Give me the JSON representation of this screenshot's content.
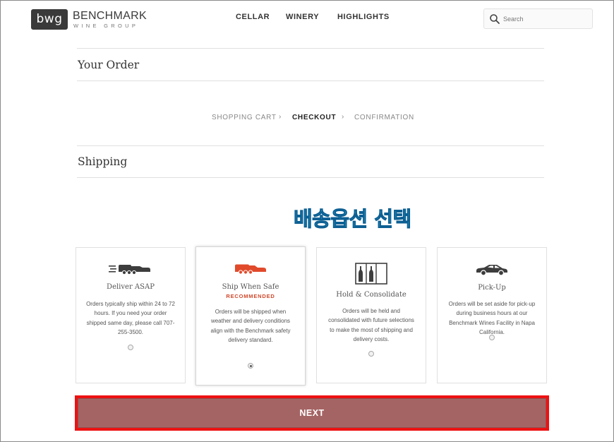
{
  "header": {
    "logo_mark": "bwg",
    "logo_name": "BENCHMARK",
    "logo_sub": "WINE GROUP",
    "nav": [
      "CELLAR",
      "WINERY",
      "HIGHLIGHTS"
    ],
    "search": {
      "placeholder": "Search",
      "icon": "magnifier-icon"
    }
  },
  "order_title": "Your Order",
  "breadcrumb": {
    "steps": [
      "SHOPPING CART",
      "CHECKOUT",
      "CONFIRMATION"
    ],
    "active": "CHECKOUT",
    "separator": "›"
  },
  "shipping_title": "Shipping",
  "annotation": "배송옵션 선택",
  "options": [
    {
      "title": "Deliver ASAP",
      "tag": "",
      "description": "Orders typically ship within 24 to 72 hours. If you need your order shipped same day, please call 707-255-3500.",
      "icon": "fast-truck-icon",
      "selected": false
    },
    {
      "title": "Ship When Safe",
      "tag": "RECOMMENDED",
      "description": "Orders will be shipped when weather and delivery conditions align with the Benchmark safety delivery standard.",
      "icon": "truck-icon",
      "selected": true
    },
    {
      "title": "Hold & Consolidate",
      "tag": "",
      "description": "Orders will be held and consolidated with future selections to make the most of shipping and delivery costs.",
      "icon": "wine-rack-icon",
      "selected": false
    },
    {
      "title": "Pick-Up",
      "tag": "",
      "description": "Orders will be set aside for pick-up during business hours at our Benchmark Wines Facility in Napa California.",
      "icon": "car-icon",
      "selected": false
    }
  ],
  "next_label": "NEXT",
  "colors": {
    "accent": "#a56464",
    "recommended": "#d0482c",
    "highlight": "#ee1111",
    "annotation": "#2bb6e6"
  }
}
